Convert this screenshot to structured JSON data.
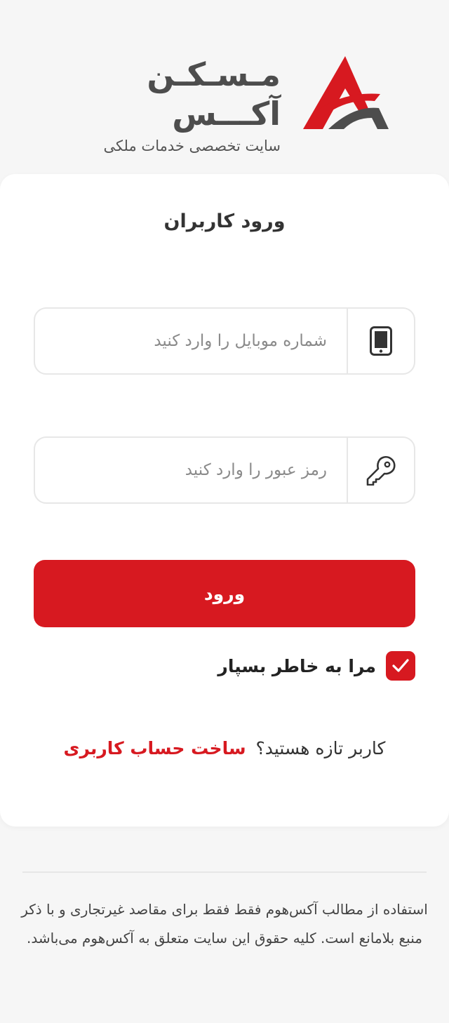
{
  "brand": {
    "name": "مـسـکـن آکـــس",
    "tagline": "سایت تخصصی خدمات ملکی",
    "colors": {
      "primary": "#d71920",
      "dark": "#4d4d4d"
    }
  },
  "login": {
    "title": "ورود کاربران",
    "mobile": {
      "placeholder": "شماره موبایل را وارد کنید",
      "icon": "mobile-phone-icon"
    },
    "password": {
      "placeholder": "رمز عبور را وارد کنید",
      "icon": "key-icon"
    },
    "submit_label": "ورود",
    "remember_label": "مرا به خاطر بسپار",
    "remember_checked": true,
    "signup_prompt": "کاربر تازه هستید؟",
    "signup_link": "ساخت حساب کاربری"
  },
  "footer": {
    "text": "استفاده از مطالب آکس‌هوم فقط فقط برای مقاصد غیرتجاری و با ذکر منبع بلامانع است. کلیه حقوق این سایت متعلق به آکس‌هوم می‌باشد."
  }
}
